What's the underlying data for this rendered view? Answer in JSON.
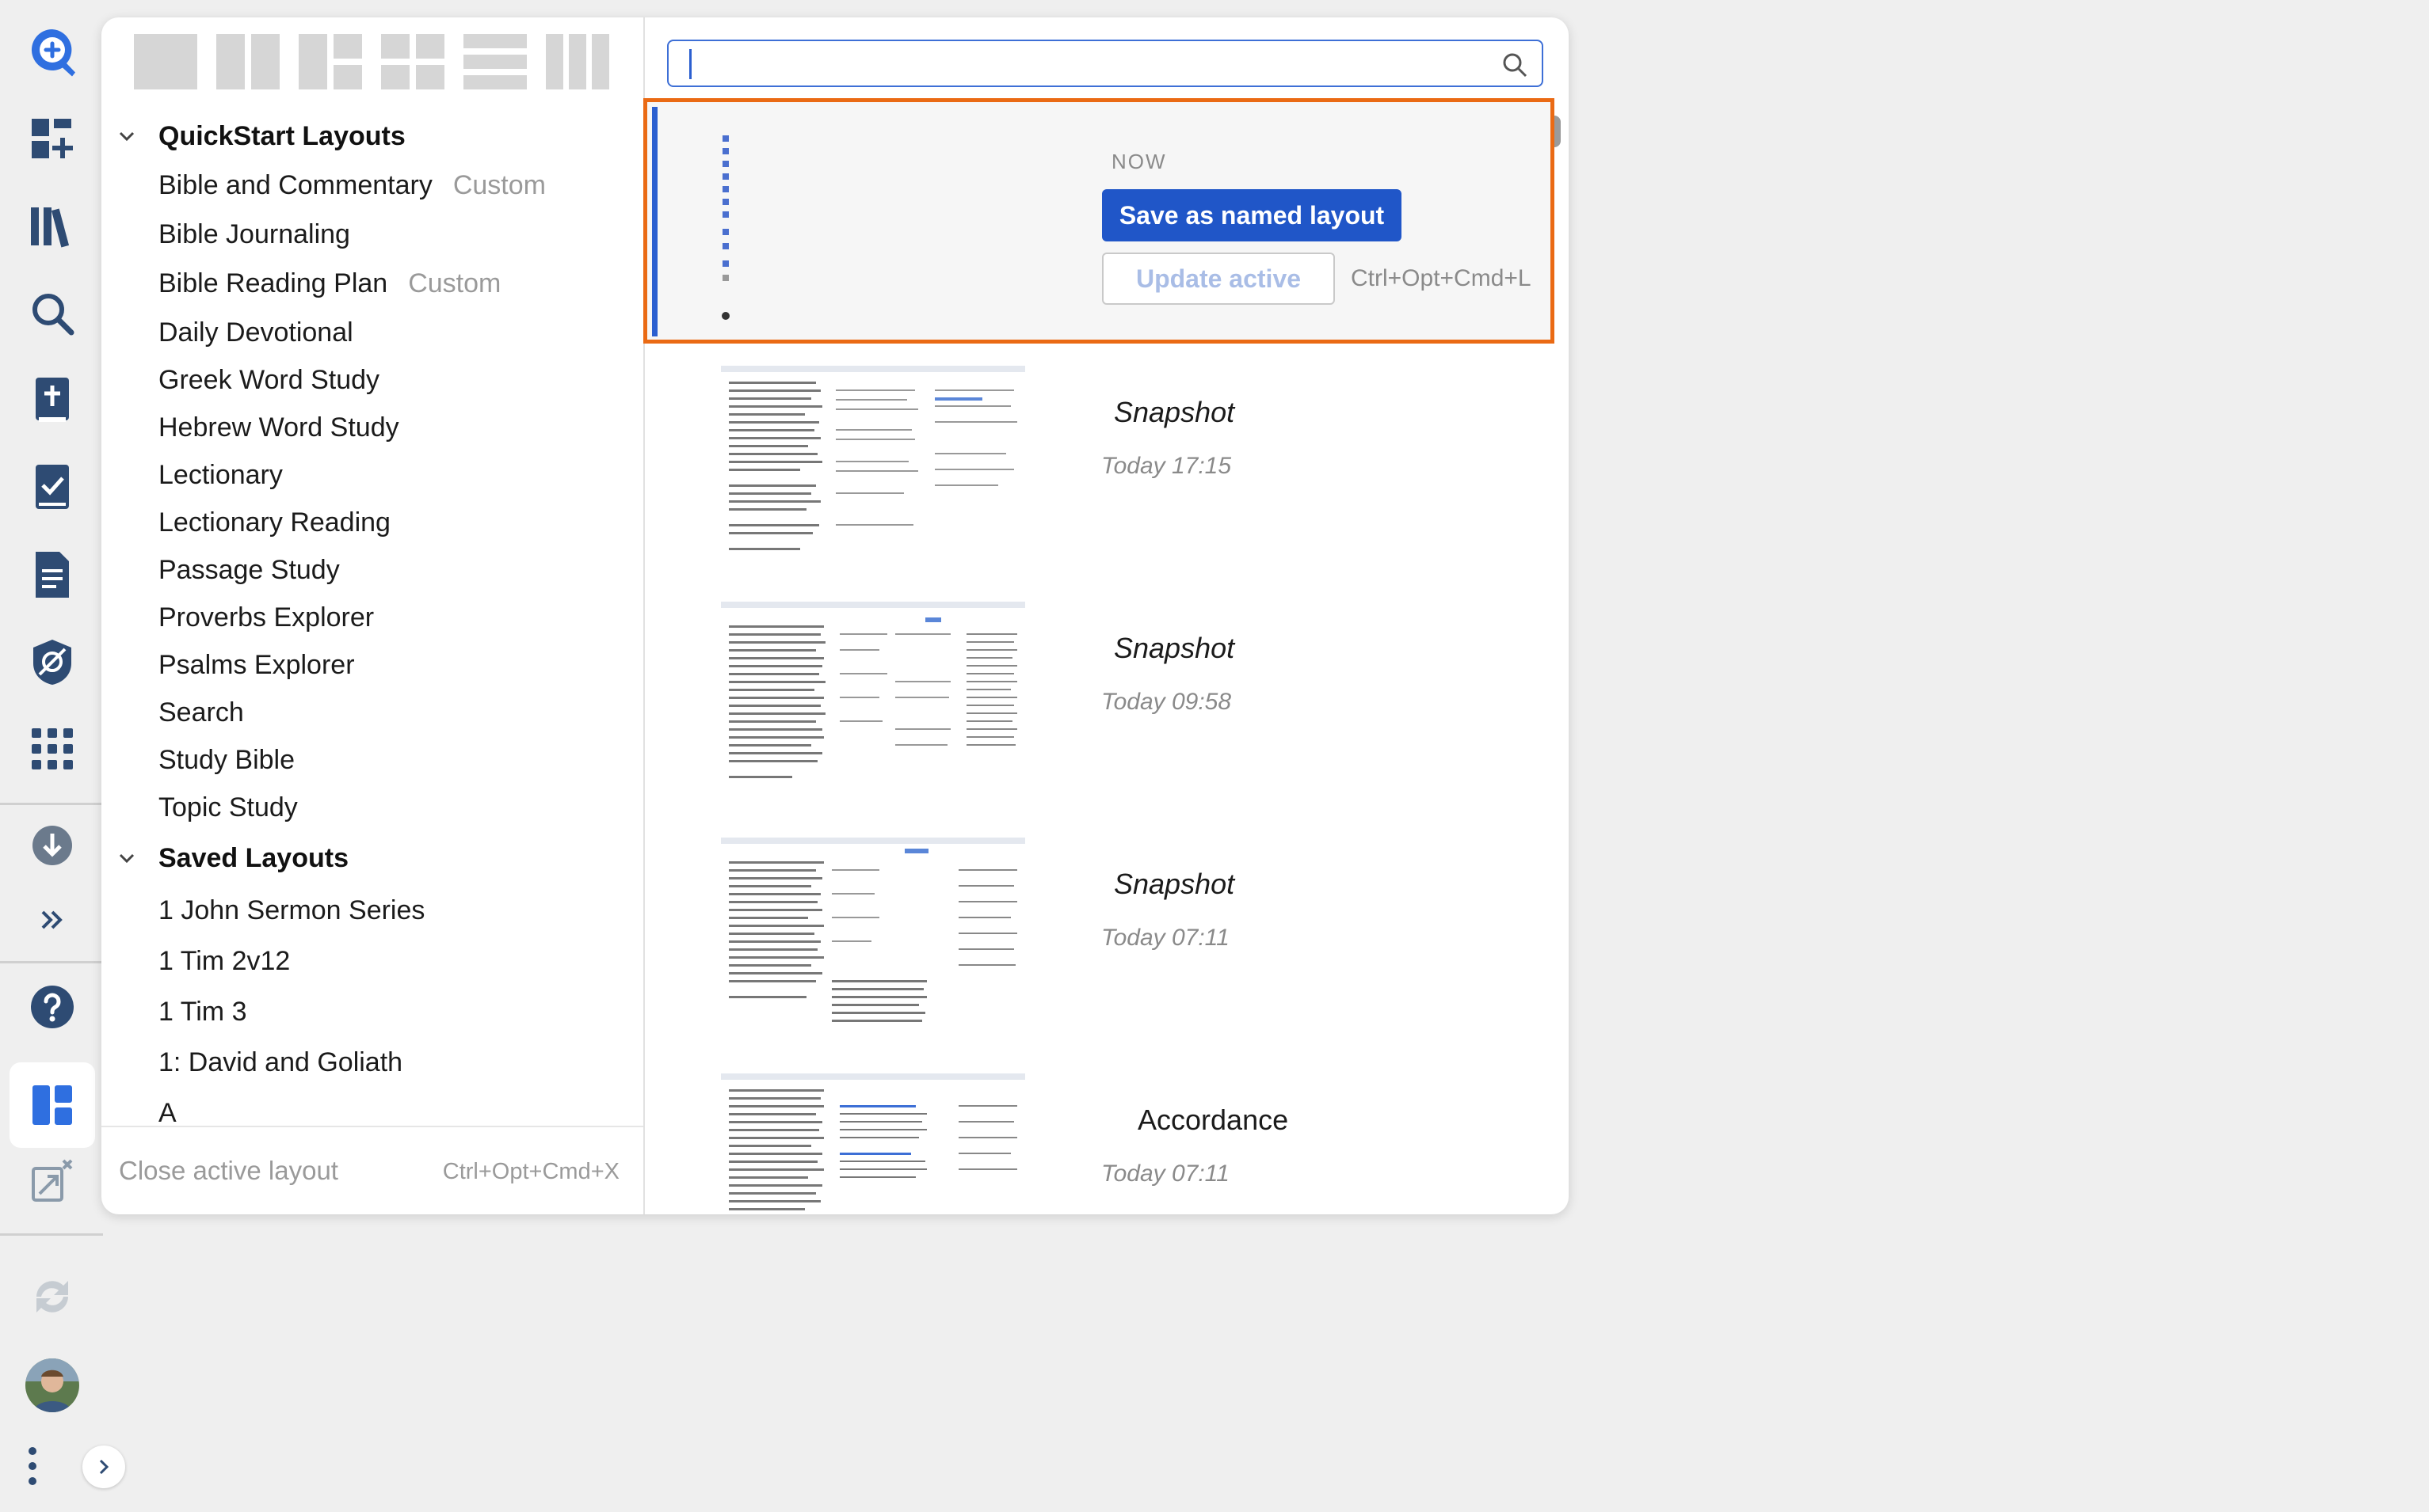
{
  "left_pane": {
    "groups": [
      {
        "label": "QuickStart Layouts",
        "items": [
          {
            "label": "Bible and Commentary",
            "tag": "Custom"
          },
          {
            "label": "Bible Journaling",
            "tag": ""
          },
          {
            "label": "Bible Reading Plan",
            "tag": "Custom"
          },
          {
            "label": "Daily Devotional",
            "tag": ""
          },
          {
            "label": "Greek Word Study",
            "tag": ""
          },
          {
            "label": "Hebrew Word Study",
            "tag": ""
          },
          {
            "label": "Lectionary",
            "tag": ""
          },
          {
            "label": "Lectionary Reading",
            "tag": ""
          },
          {
            "label": "Passage Study",
            "tag": ""
          },
          {
            "label": "Proverbs Explorer",
            "tag": ""
          },
          {
            "label": "Psalms Explorer",
            "tag": ""
          },
          {
            "label": "Search",
            "tag": ""
          },
          {
            "label": "Study Bible",
            "tag": ""
          },
          {
            "label": "Topic Study",
            "tag": ""
          }
        ]
      },
      {
        "label": "Saved Layouts",
        "items": [
          {
            "label": "1 John Sermon Series",
            "tag": ""
          },
          {
            "label": "1 Tim 2v12",
            "tag": ""
          },
          {
            "label": "1 Tim 3",
            "tag": ""
          },
          {
            "label": "1: David and Goliath",
            "tag": ""
          },
          {
            "label": "A",
            "tag": ""
          }
        ]
      }
    ],
    "close_active": {
      "label": "Close active layout",
      "shortcut": "Ctrl+Opt+Cmd+X"
    }
  },
  "right_pane": {
    "search": {
      "value": "",
      "placeholder": ""
    },
    "current": {
      "now_label": "NOW",
      "save_named_label": "Save as named layout",
      "update_active_label": "Update active",
      "update_shortcut": "Ctrl+Opt+Cmd+L"
    },
    "snapshots": [
      {
        "name": "Snapshot",
        "time": "Today 17:15"
      },
      {
        "name": "Snapshot",
        "time": "Today 09:58"
      },
      {
        "name": "Snapshot",
        "time": "Today 07:11"
      },
      {
        "name": "Accordance",
        "time": "Today 07:11"
      }
    ]
  },
  "colors": {
    "accent": "#2056c8",
    "highlight": "#ea6a14",
    "rail_icon": "#2e4b73"
  }
}
